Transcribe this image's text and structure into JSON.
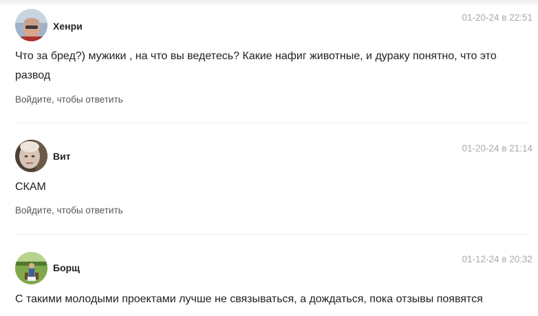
{
  "comments": [
    {
      "author": "Хенри",
      "date": "01-20-24 в 22:51",
      "text": "Что за бред?) мужики , на что вы ведетесь? Какие нафиг животные, и дураку понятно, что это развод",
      "reply_label": "Войдите, чтобы ответить"
    },
    {
      "author": "Вит",
      "date": "01-20-24 в 21:14",
      "text": "СКАМ",
      "reply_label": "Войдите, чтобы ответить"
    },
    {
      "author": "Борщ",
      "date": "01-12-24 в 20:32",
      "text": "С такими молодыми проектами лучше не связываться, а дождаться, пока отзывы появятся"
    }
  ]
}
